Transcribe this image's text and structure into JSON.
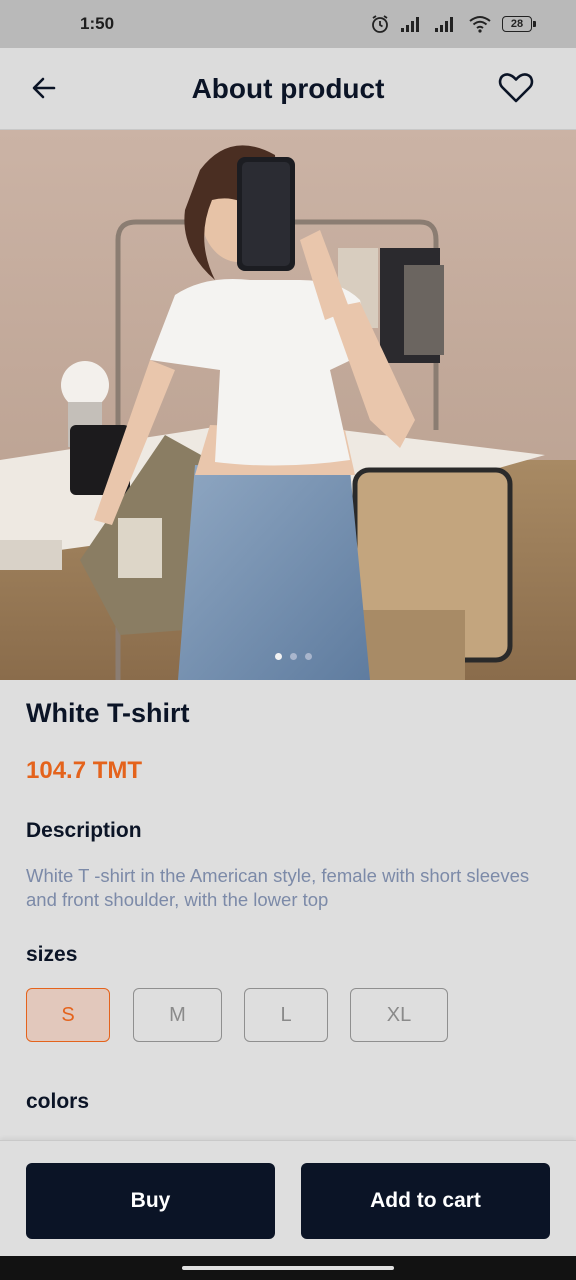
{
  "status_bar": {
    "time": "1:50",
    "battery": "28",
    "icons": [
      "alarm-icon",
      "signal-icon",
      "signal-icon",
      "wifi-icon",
      "battery-icon"
    ]
  },
  "header": {
    "title": "About product",
    "back_icon": "arrow-left-icon",
    "favorite_icon": "heart-outline-icon"
  },
  "gallery": {
    "image": "woman in white cropped t-shirt and jeans taking mirror selfie",
    "page_count": 3,
    "current_page": 1
  },
  "product": {
    "name": "White T-shirt",
    "price": "104.7 TMT",
    "description_label": "Description",
    "description": "White T -shirt in the American style, female with short sleeves and front shoulder, with the lower top"
  },
  "sizes": {
    "label": "sizes",
    "options": [
      "S",
      "M",
      "L",
      "XL"
    ],
    "selected": "S"
  },
  "colors": {
    "label": "colors"
  },
  "actions": {
    "buy_label": "Buy",
    "add_to_cart_label": "Add to cart"
  },
  "theme": {
    "accent": "#e4631c",
    "primary": "#0b1426",
    "background": "#dedede",
    "muted_text": "#7c8aa8"
  }
}
